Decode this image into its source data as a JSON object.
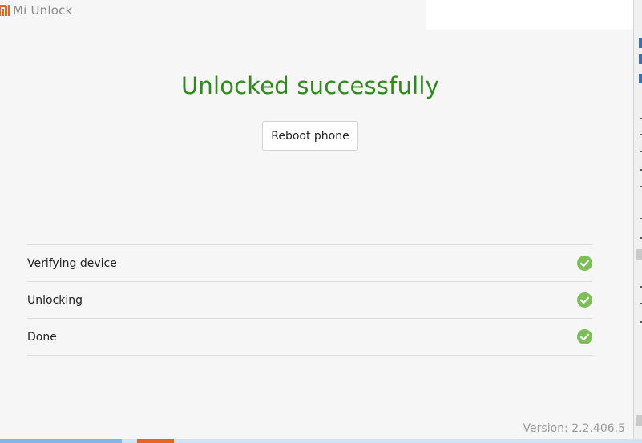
{
  "app": {
    "title": "Mi Unlock",
    "logo_icon": "mi-logo-icon",
    "brand_color": "#e4651f"
  },
  "main": {
    "status_title": "Unlocked successfully",
    "status_color": "#2f8a1c",
    "reboot_button_label": "Reboot phone"
  },
  "steps": [
    {
      "label": "Verifying device",
      "icon": "check-circle-icon",
      "status": "done"
    },
    {
      "label": "Unlocking",
      "icon": "check-circle-icon",
      "status": "done"
    },
    {
      "label": "Done",
      "icon": "check-circle-icon",
      "status": "done"
    }
  ],
  "check_color": "#7cbf56",
  "footer": {
    "version": "Version: 2.2.406.5"
  }
}
